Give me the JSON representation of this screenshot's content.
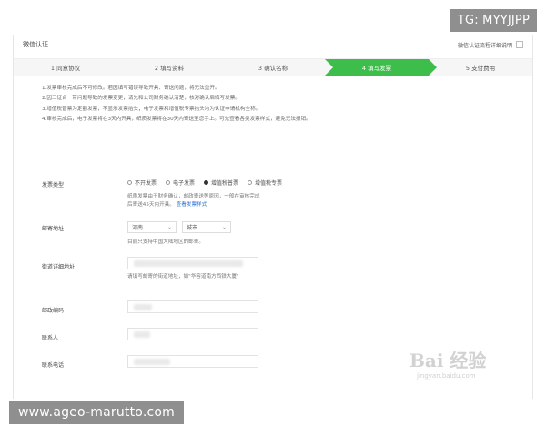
{
  "overlay": {
    "top_right_tag": "TG: MYYJJPP",
    "bottom_left_url": "www.ageo-marutto.com"
  },
  "header": {
    "title": "微信认证",
    "help_label": "微信认证流程详细说明"
  },
  "steps": [
    {
      "label": "1 同意协议"
    },
    {
      "label": "2 填写资料"
    },
    {
      "label": "3 确认名称"
    },
    {
      "label": "4 填写发票",
      "active": true
    },
    {
      "label": "5 支付费用"
    }
  ],
  "notes": [
    "1.发票审核完成后不可修改。若因填写错误导致开具、寄送问题，将无法重开。",
    "2.因三证合一带问题导致的发票变更，请先和公司财务确认清楚，核对确认后填写发票。",
    "3.增值税普票为定额发票，不显示发票抬头；电子发票和增值税专票抬头均为认证申请机构全称。",
    "4.审核完成后，电子发票将在3天内开具，纸质发票将在30天内寄送至您手上。可先查看各类发票样式，避免无法报销。"
  ],
  "invoice": {
    "label": "发票类型",
    "options": [
      {
        "label": "不开发票",
        "selected": false
      },
      {
        "label": "电子发票",
        "selected": false
      },
      {
        "label": "增值税普票",
        "selected": true
      },
      {
        "label": "增值税专票",
        "selected": false
      }
    ],
    "help": "纸质发票由于财务确认，邮政寄送等原因，一般在审核完成后寄送45天内开具。",
    "help_link": "查看发票样式"
  },
  "mailing": {
    "label": "邮寄地址",
    "province": "河南",
    "city": "城市",
    "help": "目前只支持中国大陆地区的邮寄。"
  },
  "street": {
    "label": "街道详细地址",
    "help": "请填写邮寄的街道地址，如\"华容道南方西铁大厦\""
  },
  "postal": {
    "label": "邮政编码"
  },
  "contact": {
    "label": "联系人"
  },
  "phone": {
    "label": "联系电话"
  },
  "watermark": {
    "big": "Bai 经验",
    "small": "jingyan.baidu.com"
  }
}
